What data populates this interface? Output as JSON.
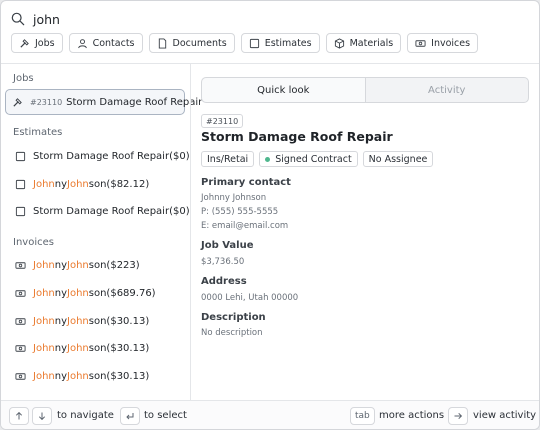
{
  "search": {
    "query": "john"
  },
  "filters": [
    "Jobs",
    "Contacts",
    "Documents",
    "Estimates",
    "Materials",
    "Invoices"
  ],
  "jobs": {
    "heading": "Jobs",
    "items": [
      {
        "number": "#23110",
        "title": "Storm Damage Roof Repair"
      }
    ]
  },
  "estimates": {
    "heading": "Estimates",
    "items": [
      {
        "parts": [
          "Storm Damage Roof Repair($0)"
        ]
      },
      {
        "parts": [
          "John",
          "ny ",
          "John",
          "son($82.12)"
        ]
      },
      {
        "parts": [
          "Storm Damage Roof Repair($0)"
        ]
      }
    ]
  },
  "invoices": {
    "heading": "Invoices",
    "items": [
      {
        "parts": [
          "John",
          "ny ",
          "John",
          "son($223)"
        ]
      },
      {
        "parts": [
          "John",
          "ny ",
          "John",
          "son($689.76)"
        ]
      },
      {
        "parts": [
          "John",
          "ny ",
          "John",
          "son($30.13)"
        ]
      },
      {
        "parts": [
          "John",
          "ny ",
          "John",
          "son($30.13)"
        ]
      },
      {
        "parts": [
          "John",
          "ny ",
          "John",
          "son($30.13)"
        ]
      }
    ]
  },
  "detail": {
    "tabs": [
      "Quick look",
      "Activity"
    ],
    "job_number": "#23110",
    "title": "Storm Damage Roof Repair",
    "tags": [
      "Ins/Retai",
      "Signed Contract",
      "No Assignee"
    ],
    "primary_contact_label": "Primary contact",
    "contact_name": "Johnny Johnson",
    "contact_phone": "P: (555) 555-5555",
    "contact_email": "E: email@email.com",
    "job_value_label": "Job Value",
    "job_value": "$3,736.50",
    "address_label": "Address",
    "address": "0000 Lehi, Utah 00000",
    "description_label": "Description",
    "description": "No description"
  },
  "footer": {
    "navigate": "to navigate",
    "select": "to select",
    "tab_key": "tab",
    "more_actions": "more actions",
    "view_activity": "view activity"
  },
  "colors": {
    "highlight": "#ea7a2e",
    "signed_dot": "#4fb78e",
    "selected_border": "#aab4c2"
  }
}
